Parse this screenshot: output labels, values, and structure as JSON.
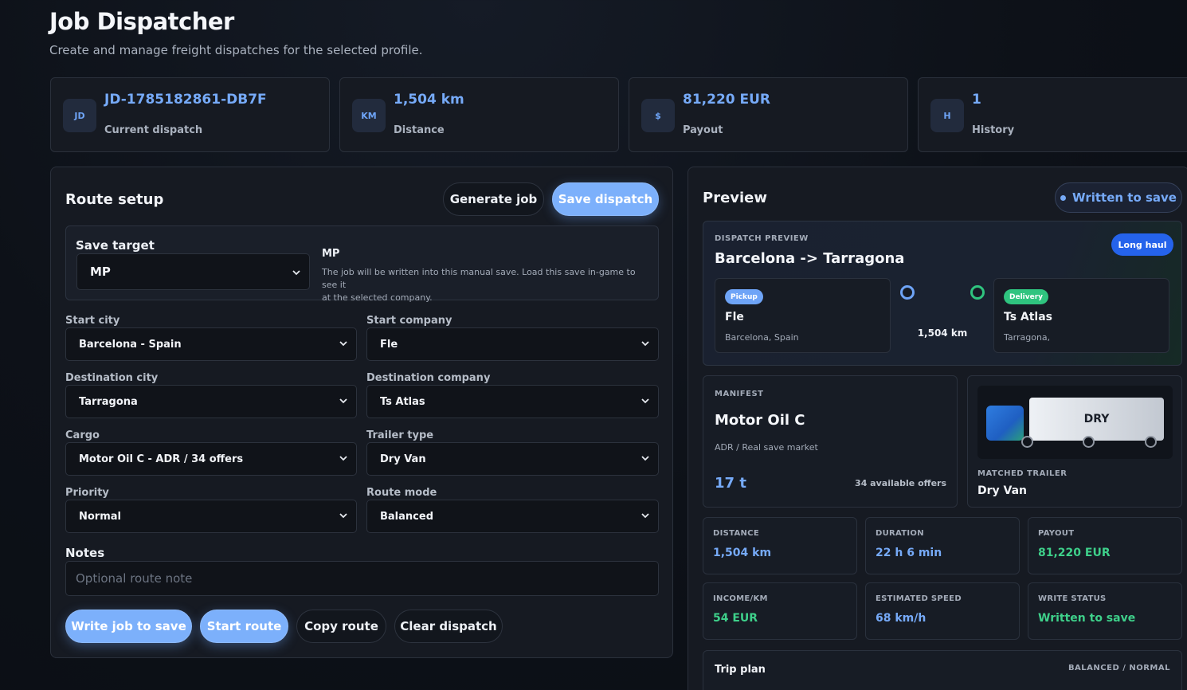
{
  "header": {
    "title": "Job Dispatcher",
    "subtitle": "Create and manage freight dispatches for the selected profile."
  },
  "stats": [
    {
      "icon": "JD",
      "value": "JD-1785182861-DB7F",
      "label": "Current dispatch"
    },
    {
      "icon": "KM",
      "value": "1,504 km",
      "label": "Distance"
    },
    {
      "icon": "$",
      "value": "81,220 EUR",
      "label": "Payout"
    },
    {
      "icon": "H",
      "value": "1",
      "label": "History"
    }
  ],
  "route_setup": {
    "title": "Route setup",
    "generate_label": "Generate job",
    "save_label": "Save dispatch",
    "save_target": {
      "label": "Save target",
      "value": "MP",
      "info_title": "MP",
      "info_text_1": "The job will be written into this manual save. Load this save in-game to see it",
      "info_text_2": "at the selected company."
    },
    "fields": {
      "start_city": {
        "label": "Start city",
        "value": "Barcelona - Spain"
      },
      "start_company": {
        "label": "Start company",
        "value": "Fle"
      },
      "dest_city": {
        "label": "Destination city",
        "value": "Tarragona"
      },
      "dest_company": {
        "label": "Destination company",
        "value": "Ts Atlas"
      },
      "cargo": {
        "label": "Cargo",
        "value": "Motor Oil C - ADR / 34 offers"
      },
      "trailer": {
        "label": "Trailer type",
        "value": "Dry Van"
      },
      "priority": {
        "label": "Priority",
        "value": "Normal"
      },
      "route_mode": {
        "label": "Route mode",
        "value": "Balanced"
      }
    },
    "notes": {
      "label": "Notes",
      "placeholder": "Optional route note"
    },
    "actions": {
      "write": "Write job to save",
      "start": "Start route",
      "copy": "Copy route",
      "clear": "Clear dispatch"
    }
  },
  "preview": {
    "title": "Preview",
    "status": "Written to save",
    "dispatch": {
      "eyebrow": "DISPATCH PREVIEW",
      "route": "Barcelona -> Tarragona",
      "badge": "Long haul",
      "pickup": {
        "badge": "Pickup",
        "name": "Fle",
        "place": "Barcelona, Spain"
      },
      "distance": "1,504 km",
      "delivery": {
        "badge": "Delivery",
        "name": "Ts Atlas",
        "place": "Tarragona,"
      }
    },
    "manifest": {
      "eyebrow": "MANIFEST",
      "cargo": "Motor Oil C",
      "market": "ADR / Real save market",
      "weight": "17 t",
      "offers": "34 available offers"
    },
    "trailer": {
      "graphic_label": "DRY",
      "eyebrow": "MATCHED TRAILER",
      "name": "Dry Van"
    },
    "metrics": [
      {
        "label": "DISTANCE",
        "value": "1,504 km",
        "color": "#76aaf8"
      },
      {
        "label": "DURATION",
        "value": "22 h 6 min",
        "color": "#76aaf8"
      },
      {
        "label": "PAYOUT",
        "value": "81,220 EUR",
        "color": "#3ed08a"
      },
      {
        "label": "INCOME/KM",
        "value": "54 EUR",
        "color": "#3ed08a"
      },
      {
        "label": "ESTIMATED SPEED",
        "value": "68 km/h",
        "color": "#76aaf8"
      },
      {
        "label": "WRITE STATUS",
        "value": "Written to save",
        "color": "#3ed08a"
      }
    ],
    "trip_plan": {
      "title": "Trip plan",
      "mode": "BALANCED / NORMAL"
    }
  },
  "colors": {
    "accent": "#76aaf8",
    "success": "#3ed08a",
    "brand_blue": "#2563eb",
    "pickup_badge": "#6ea4f7",
    "delivery_badge": "#2fc47f"
  }
}
